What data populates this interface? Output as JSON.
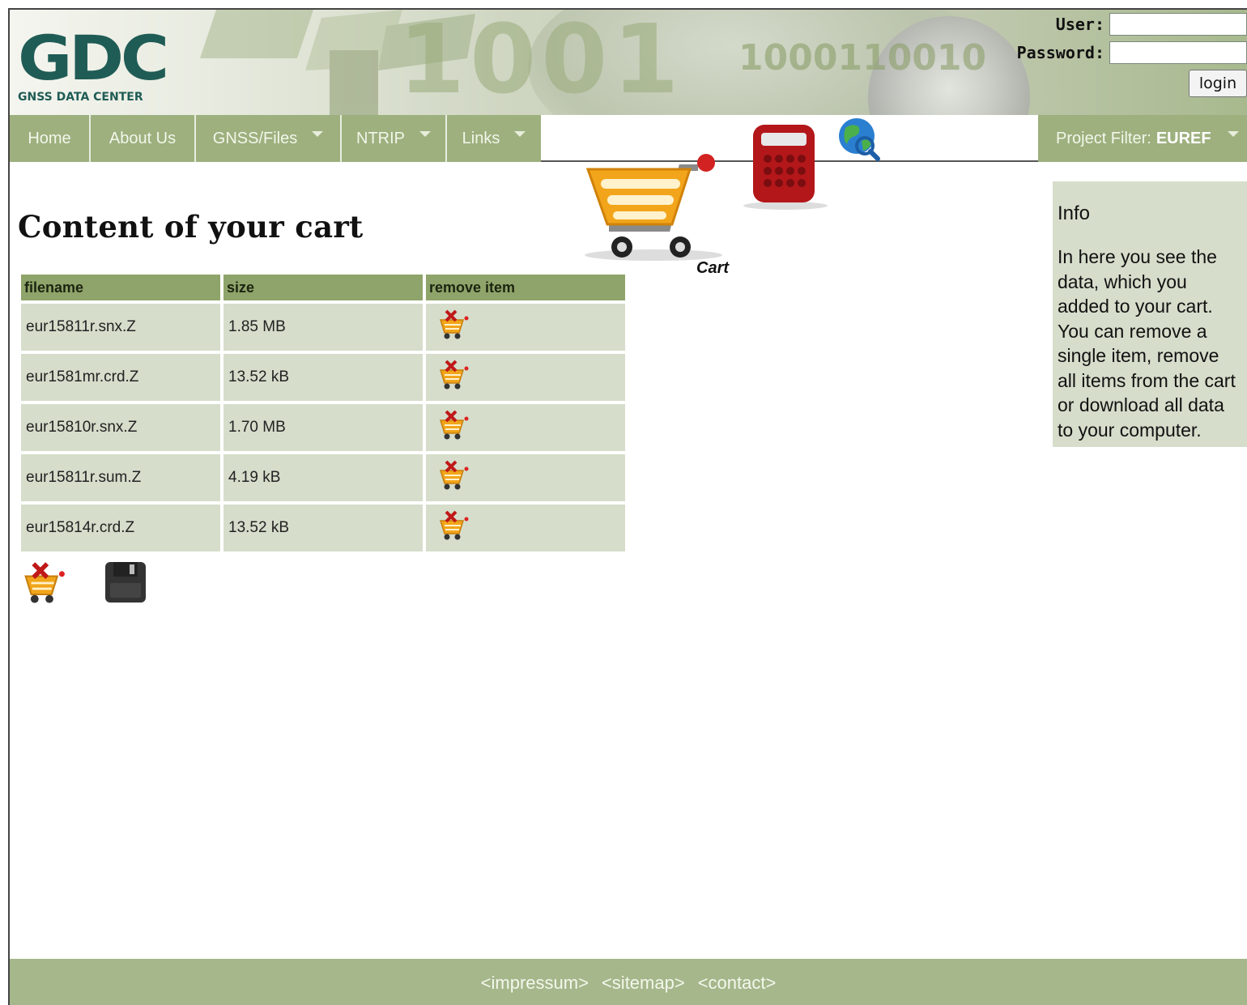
{
  "header": {
    "logo_text": "GDC",
    "logo_subtitle": "GNSS DATA CENTER",
    "banner_digits": "1001",
    "banner_digits_small": "1000110010"
  },
  "login": {
    "user_label": "User:",
    "password_label": "Password:",
    "user_value": "",
    "password_value": "",
    "button_label": "login"
  },
  "nav": {
    "items": [
      {
        "label": "Home",
        "dropdown": false
      },
      {
        "label": "About Us",
        "dropdown": false
      },
      {
        "label": "GNSS/Files",
        "dropdown": true
      },
      {
        "label": "NTRIP",
        "dropdown": true
      },
      {
        "label": "Links",
        "dropdown": true
      }
    ],
    "project_filter_label": "Project Filter:",
    "project_filter_value": "EUREF"
  },
  "toolbar": {
    "cart_label": "Cart",
    "icons": [
      "cart-icon",
      "calculator-icon",
      "globe-search-icon"
    ]
  },
  "main": {
    "title": "Content of your cart",
    "table": {
      "headers": [
        "filename",
        "size",
        "remove item"
      ],
      "rows": [
        {
          "filename": "eur15811r.snx.Z",
          "size": "1.85 MB"
        },
        {
          "filename": "eur1581mr.crd.Z",
          "size": "13.52 kB"
        },
        {
          "filename": "eur15810r.snx.Z",
          "size": "1.70 MB"
        },
        {
          "filename": "eur15811r.sum.Z",
          "size": "4.19 kB"
        },
        {
          "filename": "eur15814r.crd.Z",
          "size": "13.52 kB"
        }
      ]
    },
    "actions": [
      "remove-all-icon",
      "download-icon"
    ]
  },
  "info": {
    "title": "Info",
    "lines": [
      "In here you see the",
      "data, which you",
      "added to your cart.",
      "You can remove a",
      "single item, remove",
      "all items from the cart",
      "or download all data",
      "to your computer."
    ]
  },
  "footer": {
    "links": [
      "<impressum>",
      "<sitemap>",
      "<contact>"
    ]
  },
  "colors": {
    "nav_green": "#9db07e",
    "header_cell": "#8fa46a",
    "row_cell": "#d6ddcb",
    "footer": "#a5b78b",
    "logo": "#1f5c55"
  }
}
